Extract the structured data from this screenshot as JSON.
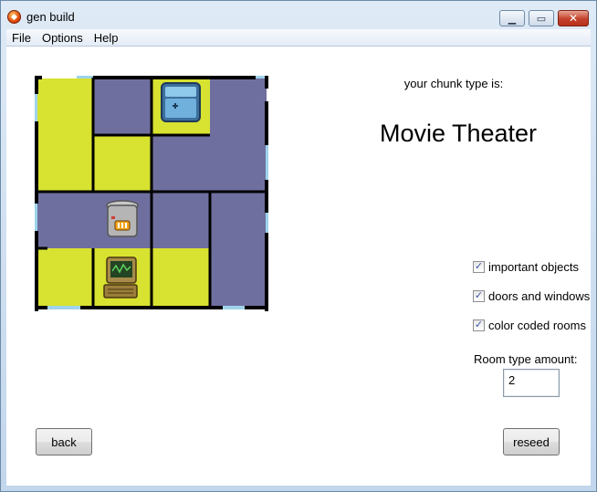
{
  "window": {
    "title": "gen build"
  },
  "menu": {
    "items": [
      "File",
      "Options",
      "Help"
    ]
  },
  "main": {
    "chunk_label": "your chunk type is:",
    "chunk_type": "Movie Theater"
  },
  "options": {
    "checkboxes": [
      {
        "label": "important objects",
        "checked": true
      },
      {
        "label": "doors and windows",
        "checked": true
      },
      {
        "label": "color coded rooms",
        "checked": true
      }
    ],
    "room_type_label": "Room type amount:",
    "room_type_value": "2"
  },
  "buttons": {
    "back": "back",
    "reseed": "reseed"
  },
  "map": {
    "room_colors": {
      "yellow": "#d8e230",
      "blue": "#6f6f9f"
    },
    "objects": [
      "fridge-icon",
      "trash-can-icon",
      "computer-icon"
    ]
  }
}
